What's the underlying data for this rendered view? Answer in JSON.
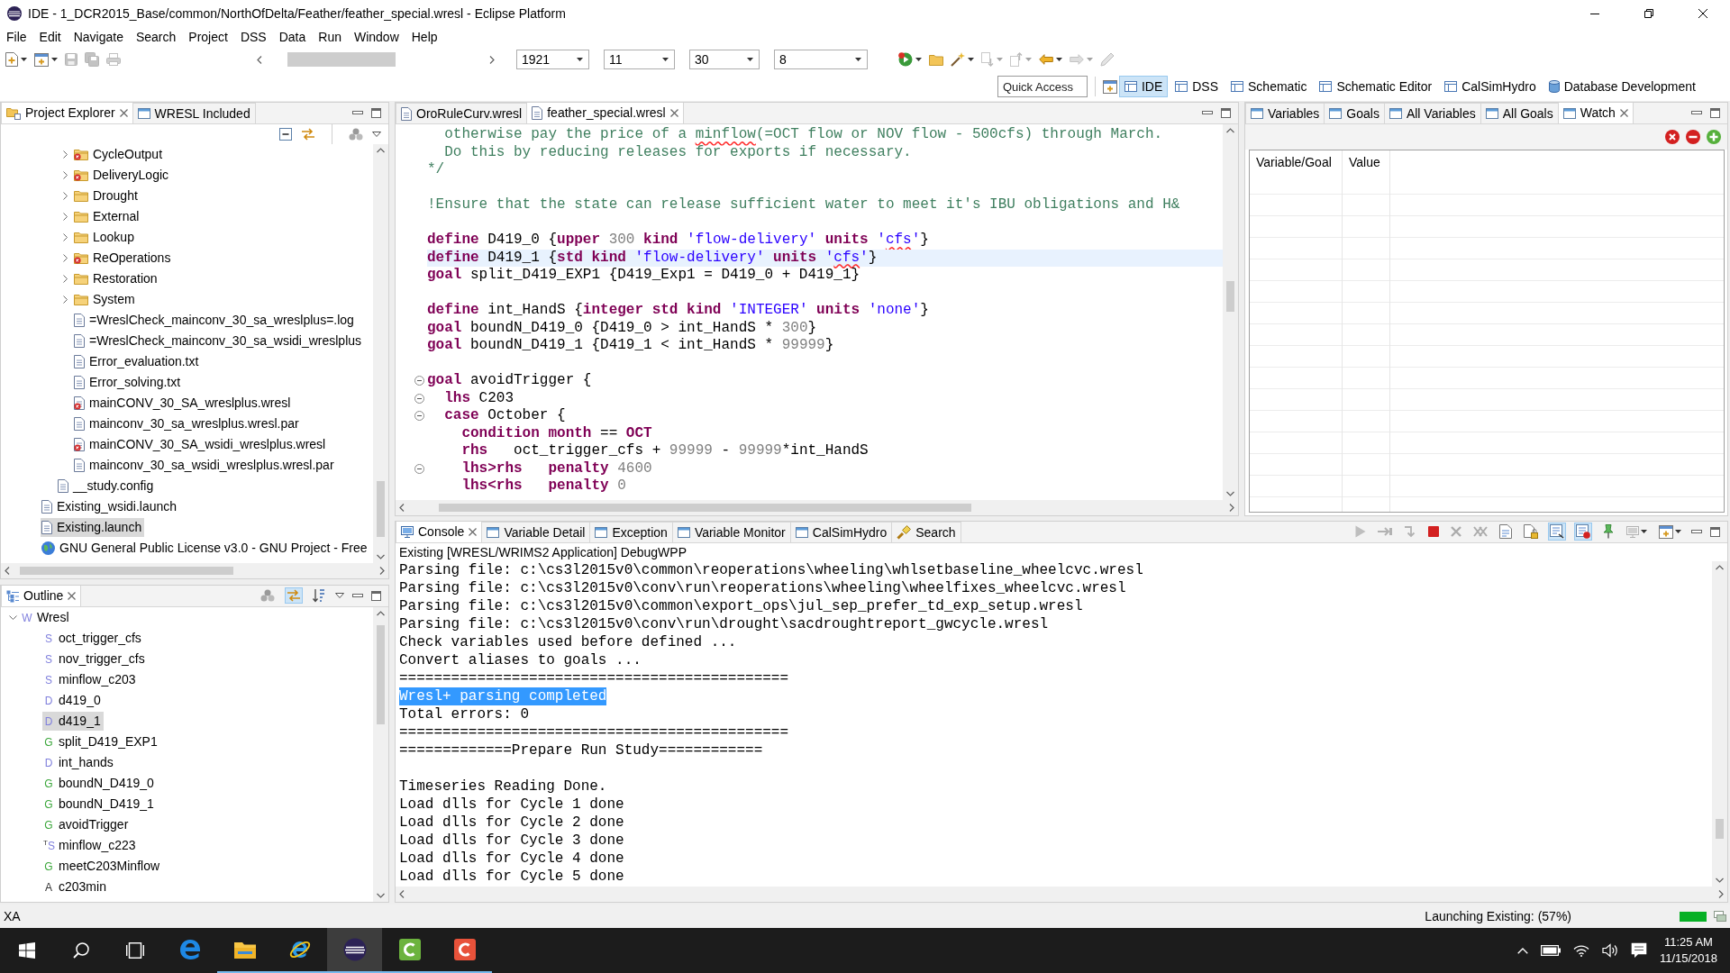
{
  "window": {
    "title": "IDE - 1_DCR2015_Base/common/NorthOfDelta/Feather/feather_special.wresl - Eclipse Platform"
  },
  "menu": [
    "File",
    "Edit",
    "Navigate",
    "Search",
    "Project",
    "DSS",
    "Data",
    "Run",
    "Window",
    "Help"
  ],
  "toolbar": {
    "left_tools": [
      {
        "kind": "new",
        "menu": true,
        "disabled": false
      },
      {
        "kind": "newitem",
        "menu": true,
        "disabled": false
      },
      {
        "kind": "save",
        "menu": false,
        "disabled": true
      },
      {
        "kind": "saveall",
        "menu": false,
        "disabled": true
      },
      {
        "kind": "print",
        "menu": false,
        "disabled": true
      }
    ],
    "selectors": [
      "1921",
      "11",
      "30",
      "8"
    ],
    "right_tools": [
      {
        "kind": "run",
        "menu": true,
        "disabled": false
      },
      {
        "kind": "open",
        "menu": false,
        "disabled": false
      },
      {
        "kind": "wand",
        "menu": true,
        "disabled": false
      },
      {
        "kind": "nextann",
        "menu": true,
        "disabled": true
      },
      {
        "kind": "prevann",
        "menu": true,
        "disabled": true
      },
      {
        "kind": "back",
        "menu": true,
        "disabled": false
      },
      {
        "kind": "forward",
        "menu": true,
        "disabled": true
      },
      {
        "kind": "pencil",
        "menu": false,
        "disabled": true
      }
    ]
  },
  "quick_access": {
    "placeholder": "Quick Access"
  },
  "perspectives": [
    {
      "label": "IDE",
      "kind": "table",
      "selected": true
    },
    {
      "label": "DSS",
      "kind": "table",
      "selected": false
    },
    {
      "label": "Schematic",
      "kind": "table",
      "selected": false
    },
    {
      "label": "Schematic Editor",
      "kind": "table",
      "selected": false
    },
    {
      "label": "CalSimHydro",
      "kind": "table",
      "selected": false
    },
    {
      "label": "Database Development",
      "kind": "database",
      "selected": false
    }
  ],
  "project_explorer": {
    "tabs": [
      {
        "label": "Project Explorer",
        "kind": "explorer",
        "selected": true
      },
      {
        "label": "WRESL Included",
        "kind": "view",
        "selected": false
      }
    ],
    "tree": [
      {
        "children": [
          {
            "children": [
              {
                "label": "CycleOutput",
                "kind": "folder",
                "expanded": false,
                "error": true,
                "selected": false
              },
              {
                "label": "DeliveryLogic",
                "kind": "folder",
                "expanded": false,
                "error": true,
                "selected": false
              },
              {
                "label": "Drought",
                "kind": "folder",
                "expanded": false,
                "error": false,
                "selected": false
              },
              {
                "label": "External",
                "kind": "folder",
                "expanded": false,
                "error": false,
                "selected": false
              },
              {
                "label": "Lookup",
                "kind": "folder",
                "expanded": false,
                "error": false,
                "selected": false
              },
              {
                "label": "ReOperations",
                "kind": "folder",
                "expanded": false,
                "error": true,
                "selected": false
              },
              {
                "label": "Restoration",
                "kind": "folder",
                "expanded": false,
                "error": false,
                "selected": false
              },
              {
                "label": "System",
                "kind": "folder",
                "expanded": false,
                "error": false,
                "selected": false
              },
              {
                "label": "=WreslCheck_mainconv_30_sa_wreslplus=.log",
                "kind": "file",
                "error": false,
                "selected": false
              },
              {
                "label": "=WreslCheck_mainconv_30_sa_wsidi_wreslplus",
                "kind": "file",
                "error": false,
                "selected": false
              },
              {
                "label": "Error_evaluation.txt",
                "kind": "file",
                "error": false,
                "selected": false
              },
              {
                "label": "Error_solving.txt",
                "kind": "file",
                "error": false,
                "selected": false
              },
              {
                "label": "mainCONV_30_SA_wreslplus.wresl",
                "kind": "file",
                "error": true,
                "selected": false
              },
              {
                "label": "mainconv_30_sa_wreslplus.wresl.par",
                "kind": "file",
                "error": false,
                "selected": false
              },
              {
                "label": "mainCONV_30_SA_wsidi_wreslplus.wresl",
                "kind": "file",
                "error": true,
                "selected": false
              },
              {
                "label": "mainconv_30_sa_wsidi_wreslplus.wresl.par",
                "kind": "file",
                "error": false,
                "selected": false
              }
            ]
          },
          {
            "label": "__study.config",
            "kind": "file",
            "error": false,
            "selected": false
          }
        ]
      },
      {
        "label": "Existing_wsidi.launch",
        "kind": "file",
        "error": false,
        "selected": false
      },
      {
        "label": "Existing.launch",
        "kind": "file",
        "error": false,
        "selected": true
      },
      {
        "label": "GNU General Public License v3.0 - GNU Project - Free",
        "kind": "web",
        "error": false,
        "selected": false
      }
    ]
  },
  "outline": {
    "tabs": [
      {
        "label": "Outline",
        "selected": true
      }
    ],
    "tools": [
      {
        "kind": "filter",
        "on": false
      },
      {
        "kind": "link",
        "on": true
      },
      {
        "kind": "sort",
        "on": false
      }
    ],
    "tree": [
      {
        "label": "Wresl",
        "icon": "W",
        "kind": "file",
        "expanded": true,
        "selected": false,
        "children": [
          {
            "label": "oct_trigger_cfs",
            "icon": "S",
            "kind": "svar",
            "selected": false
          },
          {
            "label": "nov_trigger_cfs",
            "icon": "S",
            "kind": "svar",
            "selected": false
          },
          {
            "label": "minflow_c203",
            "icon": "S",
            "kind": "svar",
            "selected": false
          },
          {
            "label": "d419_0",
            "icon": "D",
            "kind": "dvar",
            "selected": false
          },
          {
            "label": "d419_1",
            "icon": "D",
            "kind": "dvar",
            "selected": true
          },
          {
            "label": "split_D419_EXP1",
            "icon": "G",
            "kind": "goal",
            "selected": false
          },
          {
            "label": "int_hands",
            "icon": "D",
            "kind": "dvar",
            "selected": false
          },
          {
            "label": "boundN_D419_0",
            "icon": "G",
            "kind": "goal",
            "selected": false
          },
          {
            "label": "boundN_D419_1",
            "icon": "G",
            "kind": "goal",
            "selected": false
          },
          {
            "label": "avoidTrigger",
            "icon": "G",
            "kind": "goal",
            "selected": false
          },
          {
            "label": "minflow_c223",
            "icon": "$^{T}$S",
            "kind": "timeseries",
            "selected": false
          },
          {
            "label": "meetC203Minflow",
            "icon": "G",
            "kind": "goal",
            "selected": false
          },
          {
            "label": "c203min",
            "icon": "A",
            "kind": "alias",
            "selected": false
          }
        ]
      }
    ]
  },
  "editor": {
    "tabs": [
      {
        "label": "OroRuleCurv.wresl",
        "selected": false
      },
      {
        "label": "feather_special.wresl",
        "selected": true
      }
    ],
    "blocks": [
      [
        {
          "fold": false,
          "current": false,
          "tokens": [
            {
              "text": "  otherwise pay the price of a ",
              "kind": "comment"
            },
            {
              "text": "minflow",
              "kind": "comment_flagged"
            },
            {
              "text": "(=OCT flow or NOV flow - 500cfs) through March.",
              "kind": "comment"
            }
          ]
        },
        {
          "fold": false,
          "current": false,
          "tokens": [
            {
              "text": "  Do this by reducing releases for exports if necessary.",
              "kind": "comment"
            }
          ]
        },
        {
          "fold": false,
          "current": false,
          "tokens": [
            {
              "text": "*/",
              "kind": "comment"
            }
          ]
        }
      ],
      [
        {
          "fold": false,
          "current": false,
          "tokens": [
            {
              "text": "!Ensure that the state can release sufficient water to meet it's IBU obligations and H&",
              "kind": "comment"
            }
          ]
        }
      ],
      [
        {
          "fold": false,
          "current": false,
          "tokens": [
            {
              "text": "define",
              "kind": "keyword"
            },
            {
              "text": " D419_0 {",
              "kind": "plain"
            },
            {
              "text": "upper",
              "kind": "keyword"
            },
            {
              "text": " 300",
              "kind": "number"
            },
            {
              "text": " kind",
              "kind": "keyword"
            },
            {
              "text": " 'flow-delivery'",
              "kind": "string"
            },
            {
              "text": " units",
              "kind": "keyword"
            },
            {
              "text": " '",
              "kind": "string"
            },
            {
              "text": "cfs",
              "kind": "string_flagged"
            },
            {
              "text": "'",
              "kind": "string"
            },
            {
              "text": "}",
              "kind": "plain"
            }
          ]
        },
        {
          "fold": false,
          "current": true,
          "tokens": [
            {
              "text": "define",
              "kind": "keyword"
            },
            {
              "text": " D419_1 {",
              "kind": "plain"
            },
            {
              "text": "std",
              "kind": "keyword"
            },
            {
              "text": " kind",
              "kind": "keyword"
            },
            {
              "text": " 'flow-delivery'",
              "kind": "string"
            },
            {
              "text": " units",
              "kind": "keyword"
            },
            {
              "text": " '",
              "kind": "string"
            },
            {
              "text": "cfs",
              "kind": "string_flagged"
            },
            {
              "text": "'",
              "kind": "string"
            },
            {
              "text": "}",
              "kind": "plain"
            }
          ]
        },
        {
          "fold": false,
          "current": false,
          "tokens": [
            {
              "text": "goal",
              "kind": "keyword"
            },
            {
              "text": " split_D419_EXP1 {D419_Exp1 = D419_0 + D419_1}",
              "kind": "plain"
            }
          ]
        }
      ],
      [
        {
          "fold": false,
          "current": false,
          "tokens": [
            {
              "text": "define",
              "kind": "keyword"
            },
            {
              "text": " int_HandS {",
              "kind": "plain"
            },
            {
              "text": "integer",
              "kind": "keyword"
            },
            {
              "text": " std",
              "kind": "keyword"
            },
            {
              "text": " kind",
              "kind": "keyword"
            },
            {
              "text": " 'INTEGER'",
              "kind": "string"
            },
            {
              "text": " units",
              "kind": "keyword"
            },
            {
              "text": " 'none'",
              "kind": "string"
            },
            {
              "text": "}",
              "kind": "plain"
            }
          ]
        },
        {
          "fold": false,
          "current": false,
          "tokens": [
            {
              "text": "goal",
              "kind": "keyword"
            },
            {
              "text": " boundN_D419_0 {D419_0 > int_HandS * ",
              "kind": "plain"
            },
            {
              "text": "300",
              "kind": "number"
            },
            {
              "text": "}",
              "kind": "plain"
            }
          ]
        },
        {
          "fold": false,
          "current": false,
          "tokens": [
            {
              "text": "goal",
              "kind": "keyword"
            },
            {
              "text": " boundN_D419_1 {D419_1 < int_HandS * ",
              "kind": "plain"
            },
            {
              "text": "99999",
              "kind": "number"
            },
            {
              "text": "}",
              "kind": "plain"
            }
          ]
        }
      ],
      [
        {
          "fold": true,
          "current": false,
          "tokens": [
            {
              "text": "goal",
              "kind": "keyword"
            },
            {
              "text": " avoidTrigger {",
              "kind": "plain"
            }
          ]
        },
        {
          "fold": true,
          "current": false,
          "tokens": [
            {
              "text": "  lhs",
              "kind": "keyword"
            },
            {
              "text": " C203",
              "kind": "plain"
            }
          ]
        },
        {
          "fold": true,
          "current": false,
          "tokens": [
            {
              "text": "  case",
              "kind": "keyword"
            },
            {
              "text": " October {",
              "kind": "plain"
            }
          ]
        },
        {
          "fold": false,
          "current": false,
          "tokens": [
            {
              "text": "    condition",
              "kind": "keyword"
            },
            {
              "text": " month",
              "kind": "keyword"
            },
            {
              "text": " == ",
              "kind": "plain"
            },
            {
              "text": "OCT",
              "kind": "keyword"
            }
          ]
        },
        {
          "fold": false,
          "current": false,
          "tokens": [
            {
              "text": "    rhs",
              "kind": "keyword"
            },
            {
              "text": "   oct_trigger_cfs + ",
              "kind": "plain"
            },
            {
              "text": "99999",
              "kind": "number"
            },
            {
              "text": " - ",
              "kind": "plain"
            },
            {
              "text": "99999",
              "kind": "number"
            },
            {
              "text": "*int_HandS",
              "kind": "plain"
            }
          ]
        },
        {
          "fold": true,
          "current": false,
          "tokens": [
            {
              "text": "    lhs>rhs",
              "kind": "keyword"
            },
            {
              "text": "   penalty",
              "kind": "keyword"
            },
            {
              "text": " 4600",
              "kind": "number"
            }
          ]
        },
        {
          "fold": false,
          "current": false,
          "tokens": [
            {
              "text": "    lhs<rhs",
              "kind": "keyword"
            },
            {
              "text": "   penalty",
              "kind": "keyword"
            },
            {
              "text": " 0",
              "kind": "number"
            }
          ]
        }
      ]
    ]
  },
  "watch": {
    "tabs": [
      {
        "label": "Variables",
        "selected": false
      },
      {
        "label": "Goals",
        "selected": false
      },
      {
        "label": "All Variables",
        "selected": false
      },
      {
        "label": "All Goals",
        "selected": false
      },
      {
        "label": "Watch",
        "selected": true
      }
    ],
    "columns": [
      "Variable/Goal",
      "Value"
    ]
  },
  "console": {
    "tabs": [
      {
        "label": "Console",
        "kind": "console",
        "selected": true
      },
      {
        "label": "Variable Detail",
        "kind": "view",
        "selected": false
      },
      {
        "label": "Exception",
        "kind": "view",
        "selected": false
      },
      {
        "label": "Variable Monitor",
        "kind": "view",
        "selected": false
      },
      {
        "label": "CalSimHydro",
        "kind": "view",
        "selected": false
      },
      {
        "label": "Search",
        "kind": "search",
        "selected": false
      }
    ],
    "tools": [
      {
        "kind": "play",
        "disabled": true,
        "on": false,
        "menu": false
      },
      {
        "kind": "stepover",
        "disabled": true,
        "on": false,
        "menu": false
      },
      {
        "kind": "stepin",
        "disabled": true,
        "on": false,
        "menu": false
      },
      {
        "kind": "stop",
        "disabled": false,
        "on": false,
        "menu": false
      },
      {
        "kind": "remove",
        "disabled": true,
        "on": false,
        "menu": false
      },
      {
        "kind": "removeall",
        "disabled": true,
        "on": false,
        "menu": false
      },
      {
        "kind": "clear",
        "disabled": false,
        "on": false,
        "menu": false
      },
      {
        "kind": "scrolllock",
        "disabled": false,
        "on": false,
        "menu": false
      },
      {
        "kind": "stdout",
        "disabled": false,
        "on": true,
        "menu": false
      },
      {
        "kind": "stderr",
        "disabled": false,
        "on": true,
        "menu": false
      },
      {
        "kind": "pin",
        "disabled": false,
        "on": false,
        "menu": false
      },
      {
        "kind": "display",
        "disabled": true,
        "on": false,
        "menu": true
      },
      {
        "kind": "newconsole",
        "disabled": false,
        "on": false,
        "menu": true
      }
    ],
    "process": "Existing [WRESL/WRIMS2 Application] DebugWPP",
    "blocks": [
      [
        {
          "text": "Parsing file: c:\\cs3l2015v0\\common\\reoperations\\wheeling\\whlsetbaseline_wheelcvc.wresl",
          "selected": false
        },
        {
          "text": "Parsing file: c:\\cs3l2015v0\\conv\\run\\reoperations\\wheeling\\wheelfixes_wheelcvc.wresl",
          "selected": false
        },
        {
          "text": "Parsing file: c:\\cs3l2015v0\\common\\export_ops\\jul_sep_prefer_td_exp_setup.wresl",
          "selected": false
        },
        {
          "text": "Parsing file: c:\\cs3l2015v0\\conv\\run\\drought\\sacdroughtreport_gwcycle.wresl",
          "selected": false
        },
        {
          "text": "Check variables used before defined ...",
          "selected": false
        },
        {
          "text": "Convert aliases to goals ...",
          "selected": false
        },
        {
          "text": "=============================================",
          "selected": false
        },
        {
          "text": "Wresl+ parsing completed",
          "selected": true
        },
        {
          "text": "Total errors: 0",
          "selected": false
        },
        {
          "text": "=============================================",
          "selected": false
        },
        {
          "text": "=============Prepare Run Study============",
          "selected": false
        }
      ],
      [
        {
          "text": "Timeseries Reading Done.",
          "selected": false
        },
        {
          "text": "Load dlls for Cycle 1 done",
          "selected": false
        },
        {
          "text": "Load dlls for Cycle 2 done",
          "selected": false
        },
        {
          "text": "Load dlls for Cycle 3 done",
          "selected": false
        },
        {
          "text": "Load dlls for Cycle 4 done",
          "selected": false
        },
        {
          "text": "Load dlls for Cycle 5 done",
          "selected": false
        }
      ]
    ]
  },
  "status_bar": {
    "message": "XA",
    "task": "Launching Existing: (57%)",
    "progress": {
      "level": 1
    }
  },
  "taskbar": {
    "apps": [
      {
        "kind": "edge",
        "running": false,
        "selected": false
      },
      {
        "kind": "explorer",
        "running": true,
        "selected": false
      },
      {
        "kind": "ie",
        "running": true,
        "selected": false
      },
      {
        "kind": "eclipse",
        "running": true,
        "selected": true
      },
      {
        "kind": "camgreen",
        "running": true,
        "selected": false
      },
      {
        "kind": "camred",
        "running": true,
        "selected": false
      }
    ],
    "time": "11:25 AM",
    "date": "11/15/2018"
  }
}
